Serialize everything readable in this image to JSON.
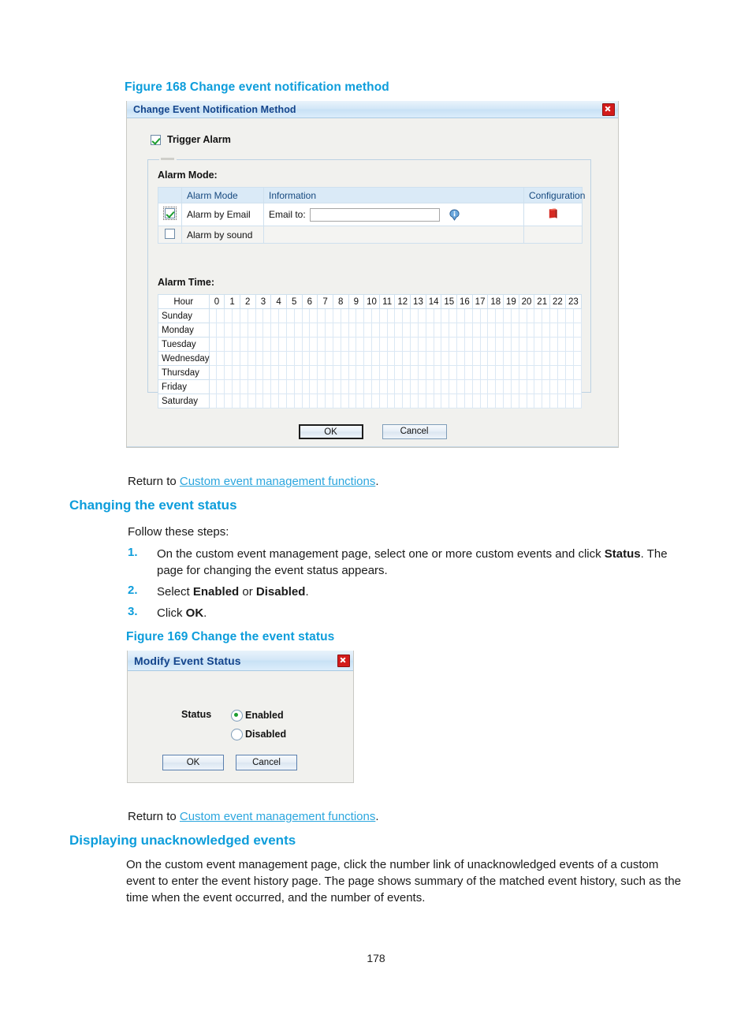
{
  "figure168": {
    "caption": "Figure 168 Change event notification method",
    "dialog": {
      "title": "Change Event Notification Method",
      "close_icon": "close-icon",
      "trigger_alarm_label": "Trigger Alarm",
      "trigger_alarm_checked": true,
      "alarm_mode_section_label": "Alarm Mode:",
      "alarm_mode_table": {
        "headers": [
          "",
          "Alarm Mode",
          "Information",
          "Configuration"
        ],
        "rows": [
          {
            "checked": true,
            "mode": "Alarm by Email",
            "email_label": "Email to:",
            "email_value": "",
            "info_icon": "info-icon",
            "config_icon": "config-book-icon"
          },
          {
            "checked": false,
            "mode": "Alarm by sound",
            "email_label": "",
            "email_value": "",
            "info_icon": "",
            "config_icon": ""
          }
        ]
      },
      "alarm_time_section_label": "Alarm Time:",
      "alarm_time_table": {
        "corner_header": "Hour",
        "hours": [
          "0",
          "1",
          "2",
          "3",
          "4",
          "5",
          "6",
          "7",
          "8",
          "9",
          "10",
          "11",
          "12",
          "13",
          "14",
          "15",
          "16",
          "17",
          "18",
          "19",
          "20",
          "21",
          "22",
          "23"
        ],
        "days": [
          "Sunday",
          "Monday",
          "Tuesday",
          "Wednesday",
          "Thursday",
          "Friday",
          "Saturday"
        ],
        "selected_cells": []
      },
      "ok_label": "OK",
      "cancel_label": "Cancel"
    }
  },
  "return_link_1": {
    "prefix": "Return to ",
    "link": "Custom event management functions",
    "suffix": "."
  },
  "section_changing_status": {
    "heading": "Changing the event status",
    "intro": "Follow these steps:",
    "steps": [
      {
        "num": "1.",
        "text_html": "On the custom event management page, select one or more custom events and click <b>Status</b>. The page for changing the event status appears."
      },
      {
        "num": "2.",
        "text_html": "Select <b>Enabled</b> or <b>Disabled</b>."
      },
      {
        "num": "3.",
        "text_html": "Click <b>OK</b>."
      }
    ]
  },
  "figure169": {
    "caption": "Figure 169 Change the event status",
    "dialog": {
      "title": "Modify Event Status",
      "close_icon": "close-icon",
      "status_label": "Status",
      "options": [
        {
          "label": "Enabled",
          "selected": true
        },
        {
          "label": "Disabled",
          "selected": false
        }
      ],
      "ok_label": "OK",
      "cancel_label": "Cancel"
    }
  },
  "return_link_2": {
    "prefix": "Return to ",
    "link": "Custom event management functions",
    "suffix": "."
  },
  "section_unacknowledged": {
    "heading": "Displaying unacknowledged events",
    "paragraph": "On the custom event management page, click the number link of unacknowledged events of a custom event to enter the event history page. The page shows summary of the matched event history, such as the time when the event occurred, and the number of events."
  },
  "footer": {
    "page_number": "178"
  },
  "colors": {
    "heading_blue": "#0d9ddb",
    "link_blue": "#2ba6de",
    "title_text_blue": "#14458c",
    "close_red": "#d31b1b",
    "check_green": "#1d9e2f",
    "table_header_blue": "#daeaf7"
  }
}
